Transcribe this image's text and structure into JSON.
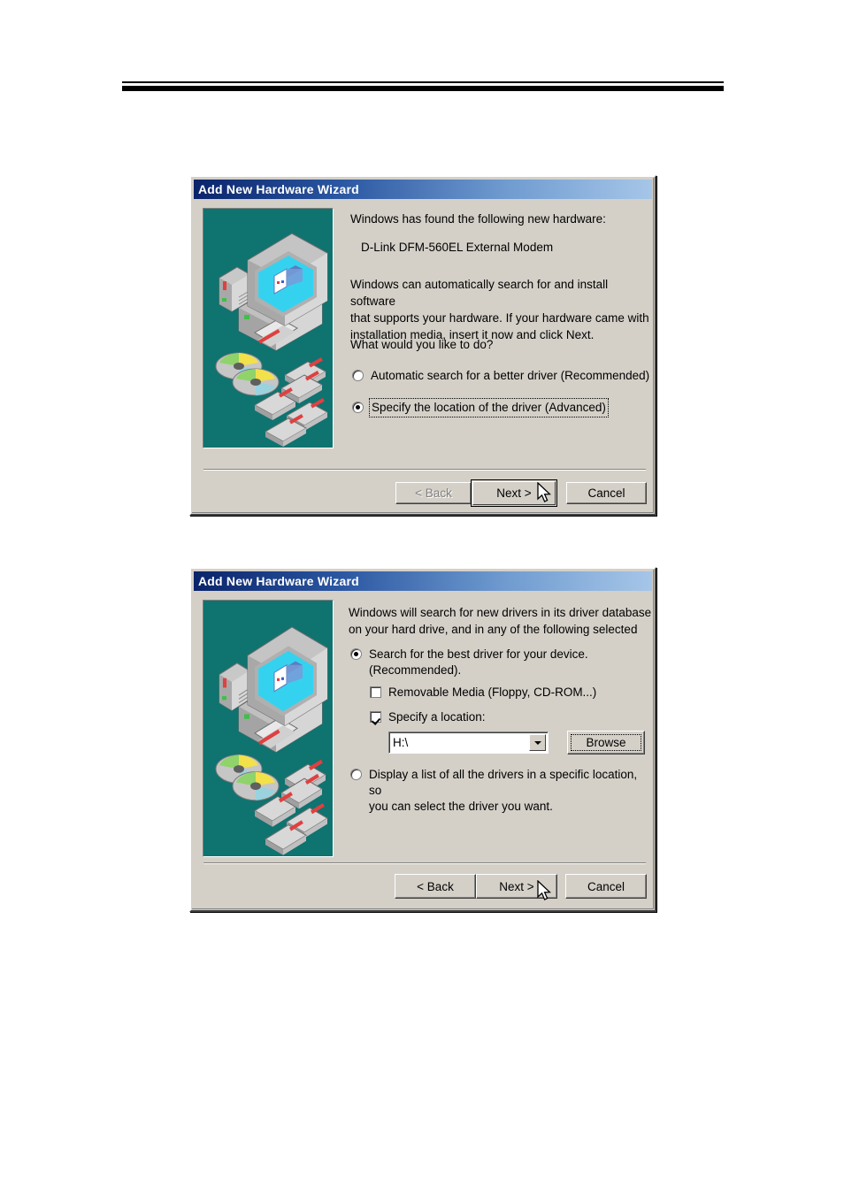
{
  "page": {
    "background_color": "#ffffff",
    "header_rule": "double-horizontal-rule"
  },
  "dialog1": {
    "title": "Add New Hardware Wizard",
    "intro_line": "Windows has found the following new hardware:",
    "device_name": "D-Link DFM-560EL External Modem",
    "description": "Windows can automatically search for and install software\nthat supports your hardware. If your hardware came with\ninstallation media, insert it now and click Next.",
    "question": "What would you like to do?",
    "options": [
      {
        "label": "Automatic search for a better driver (Recommended)",
        "accel": "A",
        "selected": false,
        "focused": false
      },
      {
        "label": "Specify the location of the driver (Advanced)",
        "accel": "S",
        "selected": true,
        "focused": true
      }
    ],
    "buttons": {
      "back": "< Back",
      "back_accel": "B",
      "back_disabled": true,
      "next": "Next >",
      "next_default": true,
      "cancel": "Cancel"
    },
    "graphic": "computer-media-illustration"
  },
  "dialog2": {
    "title": "Add New Hardware Wizard",
    "description": "Windows will search for new drivers in its driver database\non your hard drive, and in any of the following selected",
    "option_search": {
      "label": "Search for the best driver for your device.\n(Recommended).",
      "selected": true
    },
    "checkbox_removable": {
      "label": "Removable Media (Floppy, CD-ROM...)",
      "accel": "M",
      "checked": false
    },
    "checkbox_location": {
      "label": "Specify a location:",
      "accel": "l",
      "checked": true
    },
    "location_combo": {
      "value": "H:\\",
      "placeholder": ""
    },
    "browse_button": {
      "label": "Browse",
      "accel": "r",
      "focused": true
    },
    "option_display_list": {
      "label": "Display a list of all the drivers in a specific location, so\nyou can select the driver you want.",
      "accel": "D",
      "selected": false
    },
    "buttons": {
      "back": "< Back",
      "back_accel": "B",
      "back_disabled": false,
      "next": "Next >",
      "next_default": false,
      "cancel": "Cancel"
    },
    "graphic": "computer-media-illustration"
  },
  "colors": {
    "dialog_face": "#d4d0c8",
    "title_gradient_start": "#0a246a",
    "title_gradient_end": "#a6c6e8",
    "graphic_teal": "#0f7370",
    "monitor_screen": "#35d2f0"
  }
}
